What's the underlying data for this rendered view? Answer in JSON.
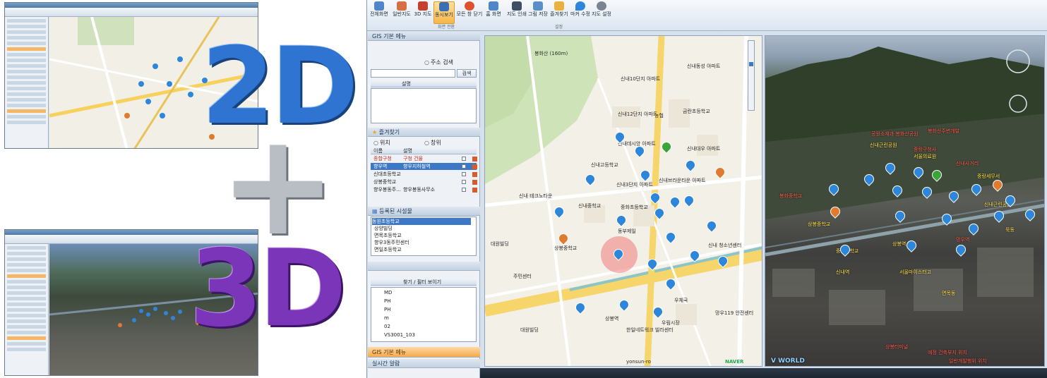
{
  "graphic": {
    "label_2d": "2D",
    "label_plus": "+",
    "label_3d": "3D",
    "color_2d": "#2f74d0",
    "color_3d": "#7a35b8"
  },
  "ribbon": {
    "buttons": [
      {
        "label": "전체화면",
        "icon": "fullscreen-icon"
      },
      {
        "label": "일반지도",
        "icon": "map-icon"
      },
      {
        "label": "3D 지도",
        "icon": "globe-icon"
      },
      {
        "label": "동시보기",
        "icon": "dual-view-icon",
        "active": true
      },
      {
        "label": "모든 창 닫기",
        "icon": "close-all-icon"
      },
      {
        "label": "홈 화면",
        "icon": "home-icon"
      },
      {
        "label": "지도 인쇄",
        "icon": "print-icon"
      },
      {
        "label": "그림 저장",
        "icon": "save-image-icon"
      },
      {
        "label": "즐겨찾기",
        "icon": "favorite-icon"
      },
      {
        "label": "마커 수정",
        "icon": "marker-icon"
      },
      {
        "label": "지도 설정",
        "icon": "settings-icon"
      }
    ],
    "groups": [
      "화면 전환",
      "설정"
    ]
  },
  "sidebar": {
    "gis_header": "GIS 기본 메뉴",
    "address_search_label": "주소 검색",
    "search_button": "검색",
    "result_header": "설명",
    "favorites": {
      "title": "즐겨찾기",
      "radio_place": "위치",
      "radio_window": "창위",
      "columns": [
        "이름",
        "설명"
      ],
      "rows": [
        {
          "name": "종합구청",
          "desc": "구청 건물",
          "selected": false
        },
        {
          "name": "향우역",
          "desc": "향우지하철역",
          "selected": true
        },
        {
          "name": "신대초등학교",
          "desc": "",
          "selected": false
        },
        {
          "name": "상봉중학교",
          "desc": "",
          "selected": false
        },
        {
          "name": "향우봉동주...",
          "desc": "향우봉동사무소",
          "selected": false
        }
      ]
    },
    "facilities": {
      "title": "등록된 시설물",
      "items": [
        "동원초등학교",
        "상양빌딩",
        "면목초등학교",
        "향우3동주민센터",
        "면일초등학교"
      ]
    },
    "layers": {
      "toolbar_label": "찾기 / 필터 보이기",
      "items": [
        "MD",
        "PH",
        "PH",
        "m",
        "02",
        "VS3001_103"
      ]
    },
    "bottom_tab": "GIS 기본 메뉴",
    "bottom_tab2": "실시간 알람"
  },
  "map2d": {
    "labels": [
      "봉화산 (160m)",
      "신내10단지 아파트",
      "신내동성 아파트",
      "신내12단지 아파트",
      "금란초등학교",
      "신내대우 아파트",
      "농협",
      "신내데시앙 아파트",
      "신내고등학교",
      "신내3단지 아파트",
      "신내 테크노타운",
      "신내브라운타운 아파트",
      "신내중학교",
      "중화초등학교",
      "상봉중학교",
      "대원빌딩",
      "동부제일",
      "신내 청소년센터",
      "우체국",
      "상봉역",
      "대원빌딩",
      "한일네트워크 빌라센터",
      "우림시장",
      "망우119 안전센터",
      "주민센터",
      "yonsun-ro"
    ],
    "zoom_label": "NAVER"
  },
  "map3d": {
    "labels": [
      {
        "text": "공원소재과 봉화산공원",
        "color": "red"
      },
      {
        "text": "봉화산주변개발",
        "color": "red"
      },
      {
        "text": "중랑구청사",
        "color": "red"
      },
      {
        "text": "신내근린공원",
        "color": "yellow"
      },
      {
        "text": "서울의료원",
        "color": "yellow"
      },
      {
        "text": "봉화중학교",
        "color": "red"
      },
      {
        "text": "신내사거리",
        "color": "red"
      },
      {
        "text": "중랑세무서",
        "color": "yellow"
      },
      {
        "text": "상봉역",
        "color": "yellow"
      },
      {
        "text": "중화중학교",
        "color": "yellow"
      },
      {
        "text": "상봉중학교",
        "color": "yellow"
      },
      {
        "text": "신내근린공원",
        "color": "yellow"
      },
      {
        "text": "망우역",
        "color": "red"
      },
      {
        "text": "묵동",
        "color": "yellow"
      },
      {
        "text": "서울마이스터고",
        "color": "yellow"
      },
      {
        "text": "신내역",
        "color": "yellow"
      },
      {
        "text": "면목동",
        "color": "yellow"
      },
      {
        "text": "상봉터미널",
        "color": "red"
      },
      {
        "text": "예정 건축부지 위치",
        "color": "red"
      },
      {
        "text": "일반개발행위 위치",
        "color": "red"
      }
    ],
    "logo": "V WORLD"
  }
}
